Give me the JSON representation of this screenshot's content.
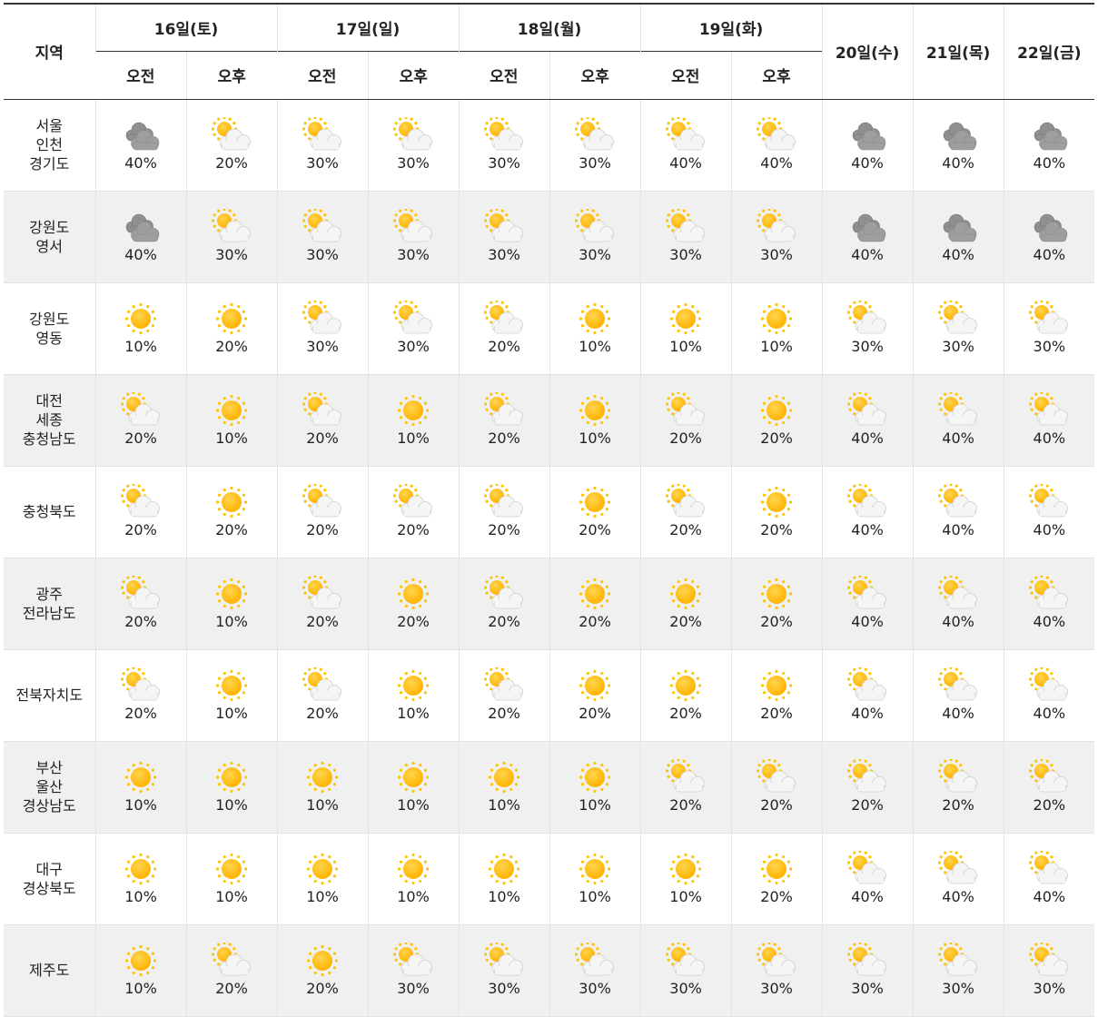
{
  "header": {
    "region_label": "지역",
    "days": [
      {
        "label": "16일(토)",
        "split": true
      },
      {
        "label": "17일(일)",
        "split": true
      },
      {
        "label": "18일(월)",
        "split": true
      },
      {
        "label": "19일(화)",
        "split": true
      },
      {
        "label": "20일(수)",
        "split": false
      },
      {
        "label": "21일(목)",
        "split": false
      },
      {
        "label": "22일(금)",
        "split": false
      }
    ],
    "am_label": "오전",
    "pm_label": "오후"
  },
  "icon_legend": {
    "sunny": "sun-icon",
    "partly": "partly-cloudy-icon",
    "cloudy": "cloudy-icon"
  },
  "rows": [
    {
      "region": [
        "서울",
        "인천",
        "경기도"
      ],
      "cells": [
        {
          "icon": "cloudy",
          "pct": "40%"
        },
        {
          "icon": "partly",
          "pct": "20%"
        },
        {
          "icon": "partly",
          "pct": "30%"
        },
        {
          "icon": "partly",
          "pct": "30%"
        },
        {
          "icon": "partly",
          "pct": "30%"
        },
        {
          "icon": "partly",
          "pct": "30%"
        },
        {
          "icon": "partly",
          "pct": "40%"
        },
        {
          "icon": "partly",
          "pct": "40%"
        },
        {
          "icon": "cloudy",
          "pct": "40%"
        },
        {
          "icon": "cloudy",
          "pct": "40%"
        },
        {
          "icon": "cloudy",
          "pct": "40%"
        }
      ]
    },
    {
      "region": [
        "강원도",
        "영서"
      ],
      "cells": [
        {
          "icon": "cloudy",
          "pct": "40%"
        },
        {
          "icon": "partly",
          "pct": "30%"
        },
        {
          "icon": "partly",
          "pct": "30%"
        },
        {
          "icon": "partly",
          "pct": "30%"
        },
        {
          "icon": "partly",
          "pct": "30%"
        },
        {
          "icon": "partly",
          "pct": "30%"
        },
        {
          "icon": "partly",
          "pct": "30%"
        },
        {
          "icon": "partly",
          "pct": "30%"
        },
        {
          "icon": "cloudy",
          "pct": "40%"
        },
        {
          "icon": "cloudy",
          "pct": "40%"
        },
        {
          "icon": "cloudy",
          "pct": "40%"
        }
      ]
    },
    {
      "region": [
        "강원도",
        "영동"
      ],
      "cells": [
        {
          "icon": "sunny",
          "pct": "10%"
        },
        {
          "icon": "sunny",
          "pct": "20%"
        },
        {
          "icon": "partly",
          "pct": "30%"
        },
        {
          "icon": "partly",
          "pct": "30%"
        },
        {
          "icon": "partly",
          "pct": "20%"
        },
        {
          "icon": "sunny",
          "pct": "10%"
        },
        {
          "icon": "sunny",
          "pct": "10%"
        },
        {
          "icon": "sunny",
          "pct": "10%"
        },
        {
          "icon": "partly",
          "pct": "30%"
        },
        {
          "icon": "partly",
          "pct": "30%"
        },
        {
          "icon": "partly",
          "pct": "30%"
        }
      ]
    },
    {
      "region": [
        "대전",
        "세종",
        "충청남도"
      ],
      "cells": [
        {
          "icon": "partly",
          "pct": "20%"
        },
        {
          "icon": "sunny",
          "pct": "10%"
        },
        {
          "icon": "partly",
          "pct": "20%"
        },
        {
          "icon": "sunny",
          "pct": "10%"
        },
        {
          "icon": "partly",
          "pct": "20%"
        },
        {
          "icon": "sunny",
          "pct": "10%"
        },
        {
          "icon": "partly",
          "pct": "20%"
        },
        {
          "icon": "sunny",
          "pct": "20%"
        },
        {
          "icon": "partly",
          "pct": "40%"
        },
        {
          "icon": "partly",
          "pct": "40%"
        },
        {
          "icon": "partly",
          "pct": "40%"
        }
      ]
    },
    {
      "region": [
        "충청북도"
      ],
      "cells": [
        {
          "icon": "partly",
          "pct": "20%"
        },
        {
          "icon": "sunny",
          "pct": "20%"
        },
        {
          "icon": "partly",
          "pct": "20%"
        },
        {
          "icon": "partly",
          "pct": "20%"
        },
        {
          "icon": "partly",
          "pct": "20%"
        },
        {
          "icon": "sunny",
          "pct": "20%"
        },
        {
          "icon": "partly",
          "pct": "20%"
        },
        {
          "icon": "sunny",
          "pct": "20%"
        },
        {
          "icon": "partly",
          "pct": "40%"
        },
        {
          "icon": "partly",
          "pct": "40%"
        },
        {
          "icon": "partly",
          "pct": "40%"
        }
      ]
    },
    {
      "region": [
        "광주",
        "전라남도"
      ],
      "cells": [
        {
          "icon": "partly",
          "pct": "20%"
        },
        {
          "icon": "sunny",
          "pct": "10%"
        },
        {
          "icon": "partly",
          "pct": "20%"
        },
        {
          "icon": "sunny",
          "pct": "20%"
        },
        {
          "icon": "partly",
          "pct": "20%"
        },
        {
          "icon": "sunny",
          "pct": "20%"
        },
        {
          "icon": "sunny",
          "pct": "20%"
        },
        {
          "icon": "sunny",
          "pct": "20%"
        },
        {
          "icon": "partly",
          "pct": "40%"
        },
        {
          "icon": "partly",
          "pct": "40%"
        },
        {
          "icon": "partly",
          "pct": "40%"
        }
      ]
    },
    {
      "region": [
        "전북자치도"
      ],
      "cells": [
        {
          "icon": "partly",
          "pct": "20%"
        },
        {
          "icon": "sunny",
          "pct": "10%"
        },
        {
          "icon": "partly",
          "pct": "20%"
        },
        {
          "icon": "sunny",
          "pct": "10%"
        },
        {
          "icon": "partly",
          "pct": "20%"
        },
        {
          "icon": "sunny",
          "pct": "20%"
        },
        {
          "icon": "sunny",
          "pct": "20%"
        },
        {
          "icon": "sunny",
          "pct": "20%"
        },
        {
          "icon": "partly",
          "pct": "40%"
        },
        {
          "icon": "partly",
          "pct": "40%"
        },
        {
          "icon": "partly",
          "pct": "40%"
        }
      ]
    },
    {
      "region": [
        "부산",
        "울산",
        "경상남도"
      ],
      "cells": [
        {
          "icon": "sunny",
          "pct": "10%"
        },
        {
          "icon": "sunny",
          "pct": "10%"
        },
        {
          "icon": "sunny",
          "pct": "10%"
        },
        {
          "icon": "sunny",
          "pct": "10%"
        },
        {
          "icon": "sunny",
          "pct": "10%"
        },
        {
          "icon": "sunny",
          "pct": "10%"
        },
        {
          "icon": "partly",
          "pct": "20%"
        },
        {
          "icon": "partly",
          "pct": "20%"
        },
        {
          "icon": "partly",
          "pct": "20%"
        },
        {
          "icon": "partly",
          "pct": "20%"
        },
        {
          "icon": "partly",
          "pct": "20%"
        }
      ]
    },
    {
      "region": [
        "대구",
        "경상북도"
      ],
      "cells": [
        {
          "icon": "sunny",
          "pct": "10%"
        },
        {
          "icon": "sunny",
          "pct": "10%"
        },
        {
          "icon": "sunny",
          "pct": "10%"
        },
        {
          "icon": "sunny",
          "pct": "10%"
        },
        {
          "icon": "sunny",
          "pct": "10%"
        },
        {
          "icon": "sunny",
          "pct": "10%"
        },
        {
          "icon": "sunny",
          "pct": "10%"
        },
        {
          "icon": "sunny",
          "pct": "20%"
        },
        {
          "icon": "partly",
          "pct": "40%"
        },
        {
          "icon": "partly",
          "pct": "40%"
        },
        {
          "icon": "partly",
          "pct": "40%"
        }
      ]
    },
    {
      "region": [
        "제주도"
      ],
      "cells": [
        {
          "icon": "sunny",
          "pct": "10%"
        },
        {
          "icon": "partly",
          "pct": "20%"
        },
        {
          "icon": "sunny",
          "pct": "20%"
        },
        {
          "icon": "partly",
          "pct": "30%"
        },
        {
          "icon": "partly",
          "pct": "30%"
        },
        {
          "icon": "partly",
          "pct": "30%"
        },
        {
          "icon": "partly",
          "pct": "30%"
        },
        {
          "icon": "partly",
          "pct": "30%"
        },
        {
          "icon": "partly",
          "pct": "30%"
        },
        {
          "icon": "partly",
          "pct": "30%"
        },
        {
          "icon": "partly",
          "pct": "30%"
        }
      ]
    }
  ],
  "colors": {
    "sun_core": "#ffb300",
    "sun_ray": "#ffc400",
    "cloud_white": "#f2f2f2",
    "cloud_grey": "#9e9e9e",
    "row_shade": "#f0f0f0",
    "grid_line": "#e3e3e3",
    "header_rule": "#333333"
  }
}
